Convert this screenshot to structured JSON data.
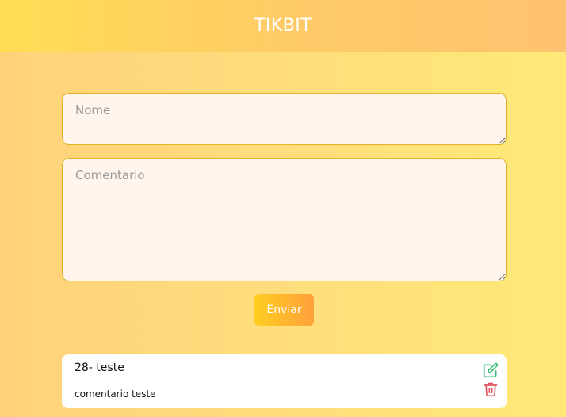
{
  "header": {
    "title": "TIKBIT"
  },
  "form": {
    "nome_placeholder": "Nome",
    "comentario_placeholder": "Comentario",
    "submit_label": "Enviar"
  },
  "comments": [
    {
      "title": "28- teste",
      "body": "comentario teste"
    }
  ],
  "colors": {
    "edit_icon": "#3cbf7a",
    "delete_icon": "#e0555f"
  }
}
